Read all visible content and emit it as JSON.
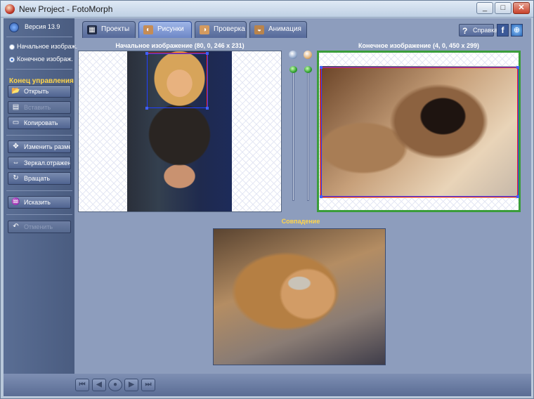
{
  "window": {
    "title": "New Project - FotoMorph",
    "minimize": "_",
    "maximize": "□",
    "close": "✕"
  },
  "sidebar": {
    "version": "Версия 13.9",
    "radios": [
      {
        "label": "Начальное изображ.",
        "checked": false
      },
      {
        "label": "Конечное изображ.",
        "checked": true
      }
    ],
    "section_title": "Конец управления",
    "buttons": [
      {
        "label": "Открыть",
        "icon": "folder-icon",
        "enabled": true
      },
      {
        "label": "Вставить",
        "icon": "paste-icon",
        "enabled": false
      },
      {
        "label": "Копировать",
        "icon": "copy-icon",
        "enabled": true
      },
      {
        "label": "Изменить размер",
        "icon": "resize-icon",
        "enabled": true
      },
      {
        "label": "Зеркал.отражение",
        "icon": "mirror-icon",
        "enabled": true
      },
      {
        "label": "Вращать",
        "icon": "rotate-icon",
        "enabled": true
      },
      {
        "label": "Исказить",
        "icon": "distort-icon",
        "enabled": true
      },
      {
        "label": "Отменить",
        "icon": "undo-icon",
        "enabled": false
      }
    ]
  },
  "tabs": [
    {
      "label": "Проекты",
      "icon": "grid-icon",
      "active": false
    },
    {
      "label": "Рисунки",
      "icon": "pictures-icon",
      "active": true
    },
    {
      "label": "Проверка",
      "icon": "preview-icon",
      "active": false
    },
    {
      "label": "Анимация",
      "icon": "animation-icon",
      "active": false
    }
  ],
  "toolbar": {
    "help_label": "Справка",
    "facebook": "f",
    "web": "⊕"
  },
  "main": {
    "source_caption": "Начальное изображение (80, 0, 246 x 231)",
    "target_caption": "Конечное изображение (4, 0, 450 x 299)",
    "result_caption": "Совпадение"
  },
  "colors": {
    "accent_yellow": "#ffd54a",
    "selection_red": "#ff2020",
    "selection_blue": "#2040ff",
    "active_green": "#3a9d3a"
  },
  "playback": [
    "⏮",
    "◀",
    "●",
    "▶",
    "⏭"
  ]
}
